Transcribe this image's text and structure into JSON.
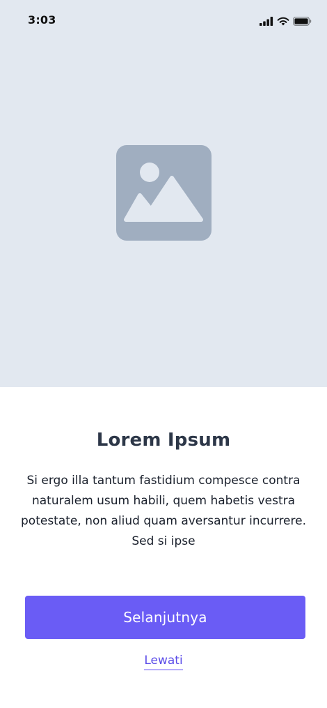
{
  "status_bar": {
    "time": "3:03"
  },
  "hero": {
    "image_icon": "image-placeholder-icon",
    "background": "#e2e8f0"
  },
  "onboarding": {
    "title": "Lorem Ipsum",
    "description": "Si ergo illa tantum fastidium compesce contra naturalem usum habili, quem habetis vestra potestate, non aliud quam aversantur incurrere. Sed si ipse"
  },
  "actions": {
    "next_label": "Selanjutnya",
    "skip_label": "Lewati"
  },
  "colors": {
    "accent": "#6a5cf5",
    "title": "#2d3748",
    "icon": "#a0aec0"
  }
}
